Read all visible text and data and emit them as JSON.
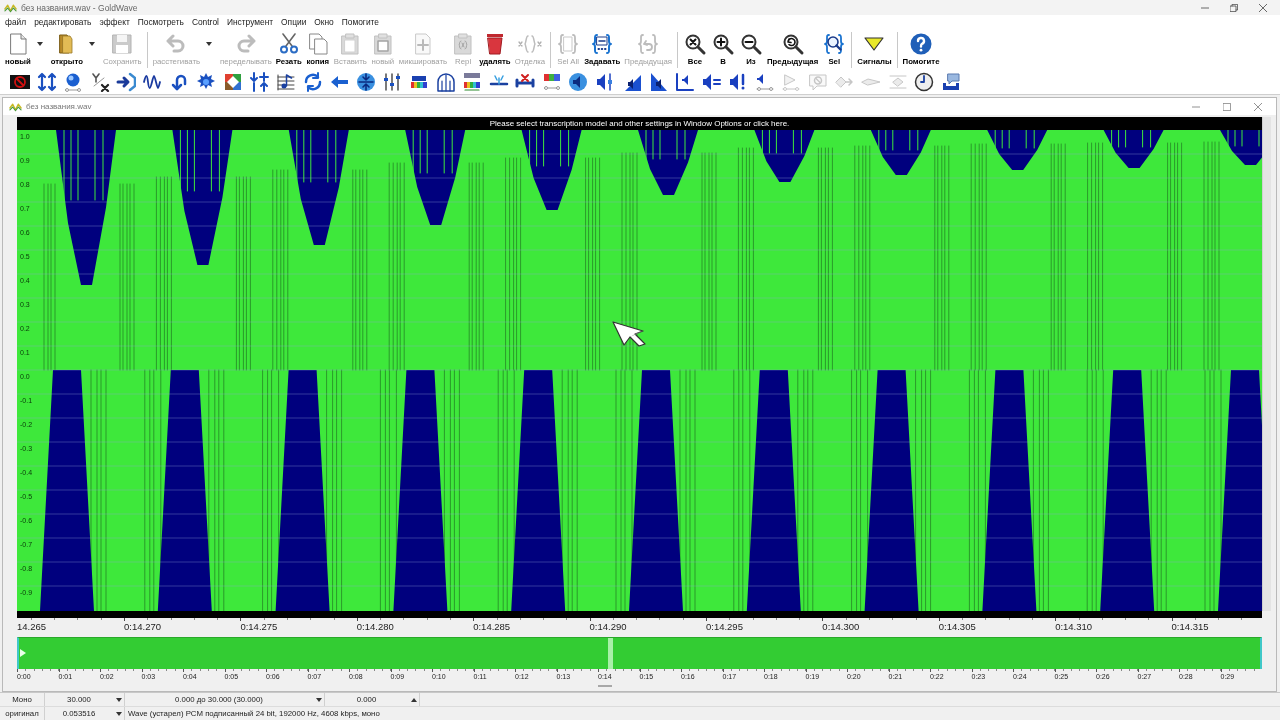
{
  "window": {
    "title": "без названия.wav - GoldWave"
  },
  "menu": [
    "файл",
    "редактировать",
    "эффект",
    "Посмотреть",
    "Control",
    "Инструмент",
    "Опции",
    "Окно",
    "Помогите"
  ],
  "toolbar": {
    "groups": [
      [
        {
          "label": "новый",
          "disabled": false,
          "dropdown": true
        },
        {
          "label": "открыто",
          "disabled": false,
          "dropdown": true
        },
        {
          "label": "Сохранить",
          "disabled": true,
          "dropdown": false
        }
      ],
      [
        {
          "label": "расстегивать",
          "disabled": true,
          "dropdown": true
        },
        {
          "label": "переделывать",
          "disabled": true,
          "dropdown": false
        },
        {
          "label": "Резать",
          "disabled": false,
          "dropdown": false
        },
        {
          "label": "копия",
          "disabled": false,
          "dropdown": false
        },
        {
          "label": "Вставить",
          "disabled": true,
          "dropdown": false
        },
        {
          "label": "новый",
          "disabled": true,
          "dropdown": false
        },
        {
          "label": "микшировать",
          "disabled": true,
          "dropdown": false
        },
        {
          "label": "Repl",
          "disabled": true,
          "dropdown": false
        },
        {
          "label": "удалять",
          "disabled": false,
          "dropdown": false
        },
        {
          "label": "Отделка",
          "disabled": true,
          "dropdown": false
        }
      ],
      [
        {
          "label": "Sel All",
          "disabled": true,
          "dropdown": false
        },
        {
          "label": "Задавать",
          "disabled": false,
          "dropdown": false
        },
        {
          "label": "Предыдущая",
          "disabled": true,
          "dropdown": false
        }
      ],
      [
        {
          "label": "Все",
          "disabled": false,
          "dropdown": false
        },
        {
          "label": "В",
          "disabled": false,
          "dropdown": false
        },
        {
          "label": "Из",
          "disabled": false,
          "dropdown": false
        },
        {
          "label": "Предыдущая",
          "disabled": false,
          "dropdown": false
        },
        {
          "label": "Sel",
          "disabled": false,
          "dropdown": false
        }
      ],
      [
        {
          "label": "Сигналы",
          "disabled": false,
          "dropdown": false
        }
      ],
      [
        {
          "label": "Помогите",
          "disabled": false,
          "dropdown": false
        }
      ]
    ]
  },
  "effects_toolbar": [
    {
      "disabled": false
    },
    {
      "disabled": false
    },
    {
      "disabled": false
    },
    {
      "disabled": false
    },
    {
      "disabled": false
    },
    {
      "disabled": false
    },
    {
      "disabled": false
    },
    {
      "disabled": false
    },
    {
      "disabled": false
    },
    {
      "disabled": false
    },
    {
      "disabled": false
    },
    {
      "disabled": false
    },
    {
      "disabled": false
    },
    {
      "disabled": false
    },
    {
      "disabled": false
    },
    {
      "disabled": false
    },
    {
      "disabled": false
    },
    {
      "disabled": false
    },
    {
      "disabled": false
    },
    {
      "disabled": false
    },
    {
      "disabled": false
    },
    {
      "disabled": false
    },
    {
      "disabled": false
    },
    {
      "disabled": false
    },
    {
      "disabled": false
    },
    {
      "disabled": false
    },
    {
      "disabled": false
    },
    {
      "disabled": false
    },
    {
      "disabled": false
    },
    {
      "disabled": true
    },
    {
      "disabled": true
    },
    {
      "disabled": true
    },
    {
      "disabled": true
    },
    {
      "disabled": true
    },
    {
      "disabled": false
    },
    {
      "disabled": false
    }
  ],
  "document": {
    "title": "без названия.wav",
    "banner": "Please select transcription model and other settings in Window Options or click here.",
    "amplitude_labels": [
      "1.0",
      "0.9",
      "0.8",
      "0.7",
      "0.6",
      "0.5",
      "0.4",
      "0.3",
      "0.2",
      "0.1",
      "0.0",
      "-0.1",
      "-0.2",
      "-0.3",
      "-0.4",
      "-0.5",
      "-0.6",
      "-0.7",
      "-0.8",
      "-0.9"
    ],
    "time_ruler": [
      "14.265",
      "0:14.270",
      "0:14.275",
      "0:14.280",
      "0:14.285",
      "0:14.290",
      "0:14.295",
      "0:14.300",
      "0:14.305",
      "0:14.310",
      "0:14.315"
    ],
    "overview_ruler": [
      "0:00",
      "0:01",
      "0:02",
      "0:03",
      "0:04",
      "0:05",
      "0:06",
      "0:07",
      "0:08",
      "0:09",
      "0:10",
      "0:11",
      "0:12",
      "0:13",
      "0:14",
      "0:15",
      "0:16",
      "0:17",
      "0:18",
      "0:19",
      "0:20",
      "0:21",
      "0:22",
      "0:23",
      "0:24",
      "0:25",
      "0:26",
      "0:27",
      "0:28",
      "0:29"
    ]
  },
  "status_bar": {
    "rows": [
      {
        "cells": [
          {
            "text": "Моно",
            "kind": "text"
          },
          {
            "text": "30.000",
            "kind": "dropdown"
          },
          {
            "text": "0.000 до 30.000 (30.000)",
            "kind": "dropdown"
          },
          {
            "text": "0.000",
            "kind": "spinner"
          }
        ]
      },
      {
        "cells": [
          {
            "text": "оригинал",
            "kind": "text"
          },
          {
            "text": "0.053516",
            "kind": "dropdown"
          },
          {
            "text": "Wave (устарел) PCM подписанный 24 bit, 192000 Hz, 4608 kbps, моно",
            "kind": "text"
          }
        ]
      }
    ]
  }
}
